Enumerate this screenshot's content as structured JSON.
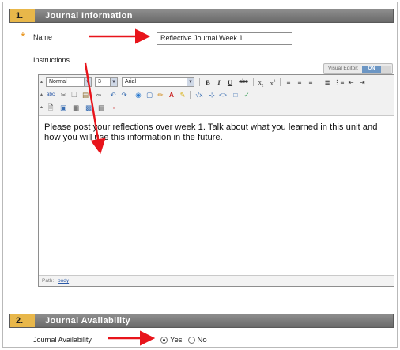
{
  "sections": [
    {
      "number": "1.",
      "title": "Journal Information"
    },
    {
      "number": "2.",
      "title": "Journal Availability"
    }
  ],
  "name_field": {
    "required_marker": "*",
    "label": "Name",
    "value": "Reflective Journal Week 1"
  },
  "instructions": {
    "label": "Instructions",
    "visual_editor_label": "Visual Editor:",
    "visual_editor_state": "ON",
    "format_select": "Normal",
    "size_select": "3",
    "font_select": "Arial",
    "body_text": "Please post your reflections over week 1.  Talk about what you learned in this unit and how you will use this information in the future.",
    "path_label": "Path:",
    "path_value": "body"
  },
  "toolbar_icons": {
    "row1": [
      "bold-icon",
      "italic-icon",
      "underline-icon",
      "strikethrough-icon",
      "subscript-icon",
      "superscript-icon",
      "align-left-icon",
      "align-center-icon",
      "align-right-icon",
      "ordered-list-icon",
      "unordered-list-icon",
      "outdent-icon",
      "indent-icon"
    ],
    "row2": [
      "spellcheck-icon",
      "cut-icon",
      "copy-icon",
      "paste-icon",
      "link-icon",
      "undo-icon",
      "redo-icon",
      "web-link-icon",
      "box-icon",
      "pencil-icon",
      "text-color-icon",
      "highlight-icon",
      "math-icon",
      "embed-icon",
      "html-icon",
      "table-icon",
      "check-icon"
    ],
    "row3": [
      "file-icon",
      "image-icon",
      "mashup-icon",
      "media-icon",
      "page-icon",
      "pdf-icon"
    ]
  },
  "availability": {
    "label": "Journal Availability",
    "options": [
      "Yes",
      "No"
    ],
    "selected": "Yes"
  },
  "colors": {
    "header_bg": "#7a7a7a",
    "number_bg": "#e8b74a",
    "arrow": "#e8141b",
    "asterisk": "#e8931a",
    "toggle_on": "#6c96c4"
  }
}
